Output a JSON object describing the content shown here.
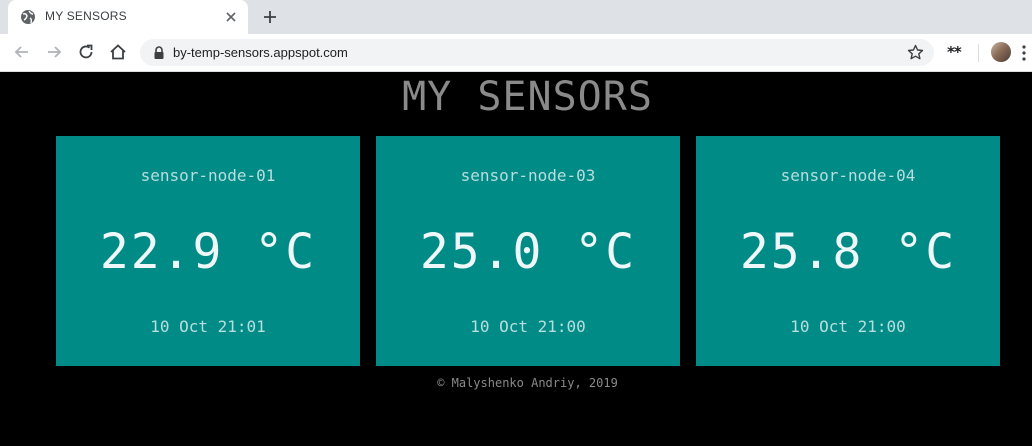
{
  "browser": {
    "tab_title": "MY SENSORS",
    "url": "by-temp-sensors.appspot.com",
    "extension_label": "**"
  },
  "page": {
    "title": "MY SENSORS",
    "sensors": [
      {
        "name": "sensor-node-01",
        "temperature": "22.9 °C",
        "time": "10 Oct 21:01"
      },
      {
        "name": "sensor-node-03",
        "temperature": "25.0 °C",
        "time": "10 Oct 21:00"
      },
      {
        "name": "sensor-node-04",
        "temperature": "25.8 °C",
        "time": "10 Oct 21:00"
      }
    ],
    "footer": "© Malyshenko Andriy, 2019"
  },
  "colors": {
    "card_background": "#008b87",
    "page_background": "#000000",
    "title_text": "#8a8a8a"
  }
}
